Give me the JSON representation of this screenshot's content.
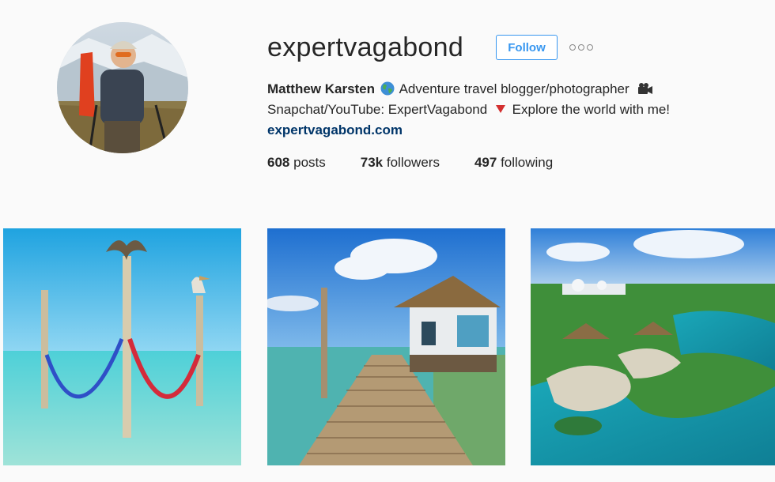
{
  "profile": {
    "username": "expertvagabond",
    "follow_label": "Follow",
    "more_icon": "ellipsis-icon",
    "full_name": "Matthew Karsten",
    "bio_line1": "Adventure travel blogger/photographer",
    "bio_line2_a": "Snapchat/YouTube: ExpertVagabond",
    "bio_line2_b": "Explore the world with me!",
    "website": "expertvagabond.com",
    "icons": [
      "globe-icon",
      "movie-camera-icon",
      "red-triangle-icon"
    ]
  },
  "stats": {
    "posts_count": "608",
    "posts_label": "posts",
    "followers_count": "73k",
    "followers_label": "followers",
    "following_count": "497",
    "following_label": "following"
  },
  "colors": {
    "accent": "#3897f0",
    "link": "#003569",
    "background": "#fafafa"
  },
  "posts": [
    {
      "subject": "hammocks-on-poles-over-turquoise-water-with-pelicans"
    },
    {
      "subject": "wooden-pier-to-thatched-hut"
    },
    {
      "subject": "aerial-tropical-lagoon-with-huts"
    }
  ]
}
